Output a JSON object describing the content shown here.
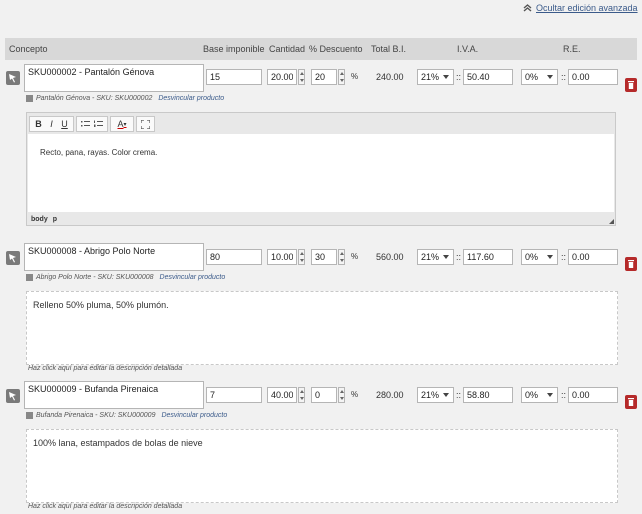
{
  "toggle_link": "Ocultar edición avanzada",
  "headers": {
    "concepto": "Concepto",
    "base": "Base imponible",
    "cantidad": "Cantidad",
    "descuento": "% Descuento",
    "total": "Total B.I.",
    "iva": "I.V.A.",
    "re": "R.E."
  },
  "rows": [
    {
      "concepto": "SKU000002 - Pantalón Génova",
      "base": "15",
      "cantidad": "20.00",
      "descuento": "20",
      "pct": "%",
      "total": "240.00",
      "iva_sel": "21%",
      "iva_sep": "::",
      "iva_val": "50.40",
      "re_sel": "0%",
      "re_sep": "::",
      "re_val": "0.00",
      "sub_product": "Pantalón Génova - SKU: SKU000002",
      "unlink": "Desvincular producto",
      "description": "Recto, pana, rayas. Color crema.",
      "editor_status": [
        "body",
        "p"
      ]
    },
    {
      "concepto": "SKU000008 - Abrigo Polo Norte",
      "base": "80",
      "cantidad": "10.00",
      "descuento": "30",
      "pct": "%",
      "total": "560.00",
      "iva_sel": "21%",
      "iva_sep": "::",
      "iva_val": "117.60",
      "re_sel": "0%",
      "re_sep": "::",
      "re_val": "0.00",
      "sub_product": "Abrigo Polo Norte - SKU: SKU000008",
      "unlink": "Desvincular producto",
      "description": "Relleno 50% pluma, 50% plumón.",
      "hint": "Haz click aquí para editar la descripción detallada"
    },
    {
      "concepto": "SKU000009 - Bufanda Pirenaica",
      "base": "7",
      "cantidad": "40.00",
      "descuento": "0",
      "pct": "%",
      "total": "280.00",
      "iva_sel": "21%",
      "iva_sep": "::",
      "iva_val": "58.80",
      "re_sel": "0%",
      "re_sep": "::",
      "re_val": "0.00",
      "sub_product": "Bufanda Pirenaica - SKU: SKU000009",
      "unlink": "Desvincular producto",
      "description": "100% lana, estampados de bolas de nieve",
      "hint": "Haz click aquí para editar la descripción detallada"
    }
  ],
  "toolbar": {
    "bold": "B",
    "italic": "I",
    "underline": "U",
    "text_color": "A"
  },
  "colors": {
    "header_bg": "#d8d8d8",
    "trash": "#b52a2a",
    "link": "#3a5a8a"
  }
}
